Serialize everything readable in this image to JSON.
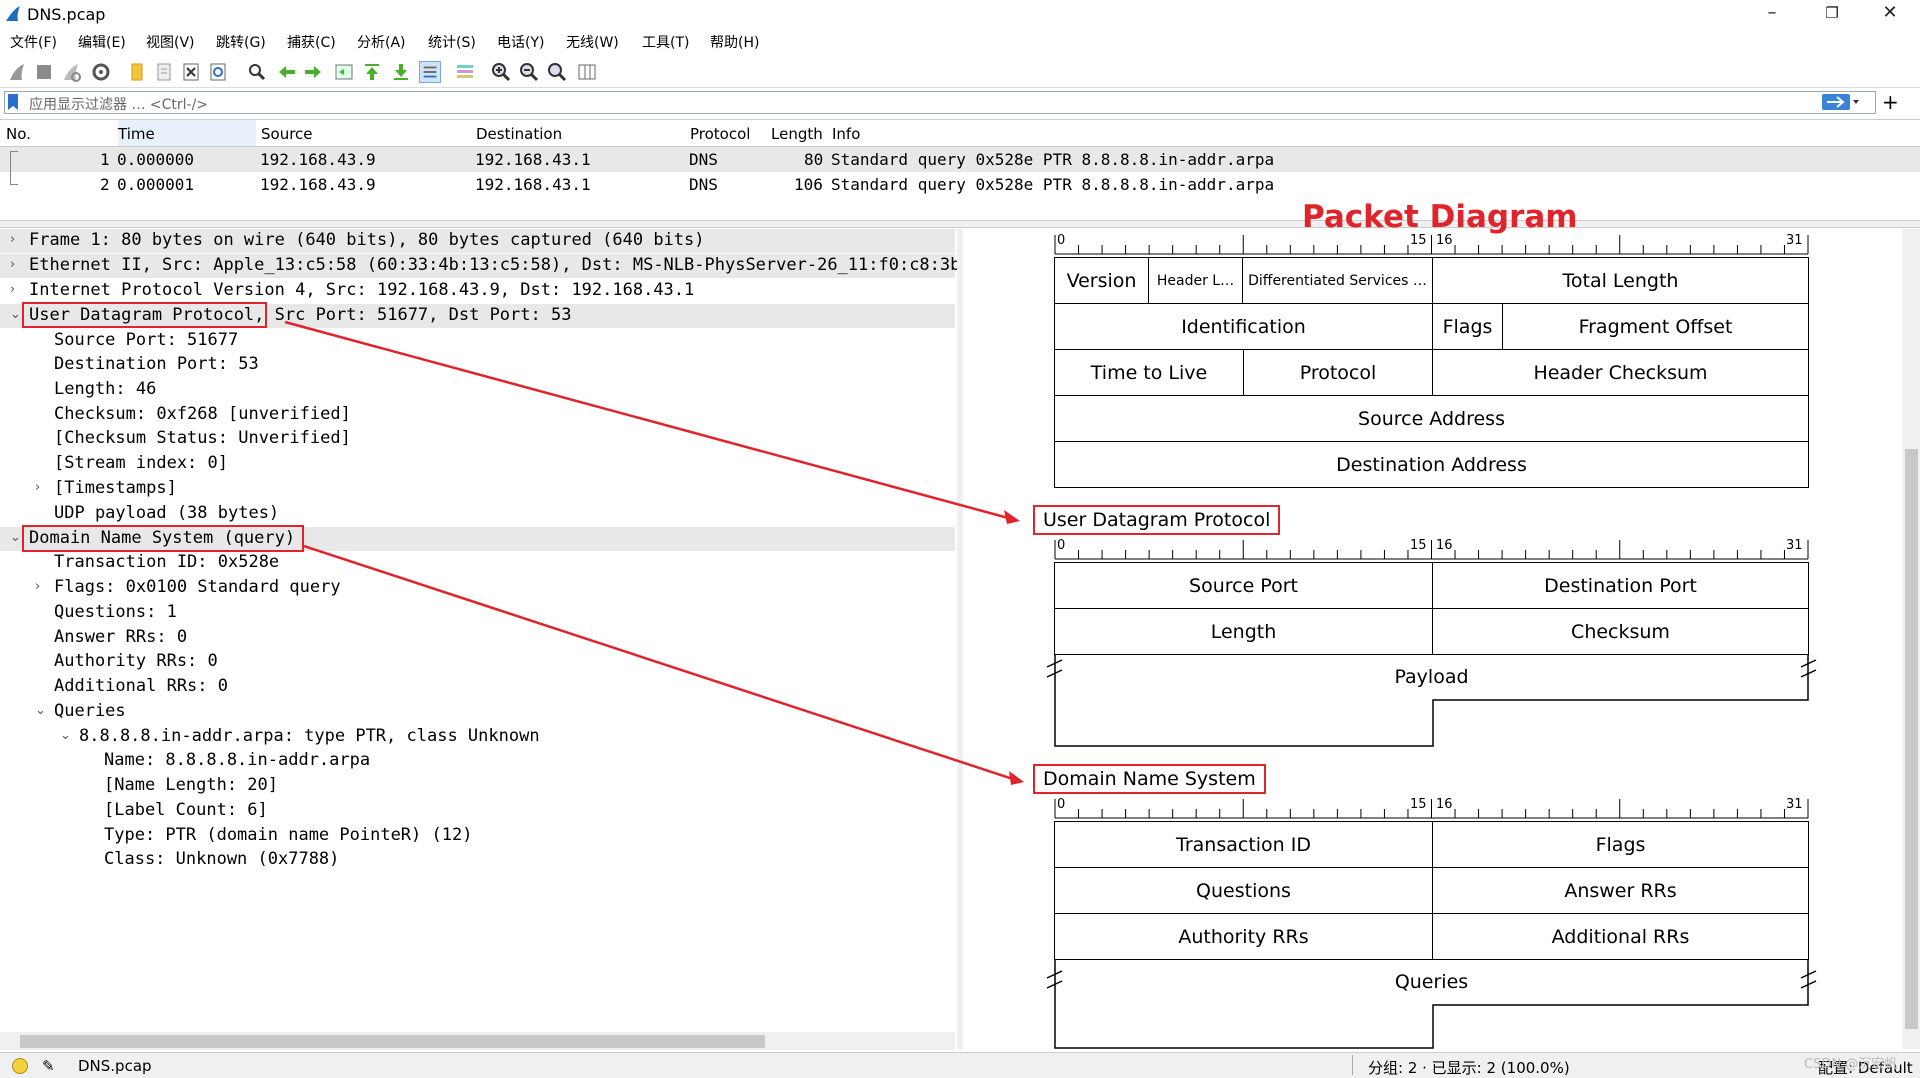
{
  "window": {
    "title": "DNS.pcap",
    "minimize": "–",
    "maximize": "❐",
    "close": "✕"
  },
  "menu": [
    "文件(F)",
    "编辑(E)",
    "视图(V)",
    "跳转(G)",
    "捕获(C)",
    "分析(A)",
    "统计(S)",
    "电话(Y)",
    "无线(W)",
    "工具(T)",
    "帮助(H)"
  ],
  "filter": {
    "placeholder": "应用显示过滤器 … <Ctrl-/>",
    "add": "+"
  },
  "packet_list": {
    "columns": [
      "No.",
      "Time",
      "Source",
      "Destination",
      "Protocol",
      "Length",
      "Info"
    ],
    "rows": [
      {
        "no": "1",
        "time": "0.000000",
        "source": "192.168.43.9",
        "destination": "192.168.43.1",
        "protocol": "DNS",
        "length": "80",
        "info": "Standard query 0x528e PTR 8.8.8.8.in-addr.arpa"
      },
      {
        "no": "2",
        "time": "0.000001",
        "source": "192.168.43.9",
        "destination": "192.168.43.1",
        "protocol": "DNS",
        "length": "106",
        "info": "Standard query 0x528e PTR 8.8.8.8.in-addr.arpa"
      }
    ]
  },
  "detail_tree": [
    {
      "text": "Frame 1: 80 bytes on wire (640 bits), 80 bytes captured (640 bits)",
      "arrow": ">"
    },
    {
      "text": "Ethernet II, Src: Apple_13:c5:58 (60:33:4b:13:c5:58), Dst: MS-NLB-PhysServer-26_11:f0:c8:3b",
      "arrow": ">"
    },
    {
      "text": "Internet Protocol Version 4, Src: 192.168.43.9, Dst: 192.168.43.1",
      "arrow": ">"
    },
    {
      "text": "User Datagram Protocol, Src Port: 51677, Dst Port: 53",
      "arrow": "v"
    },
    {
      "text": "Source Port: 51677",
      "arrow": ""
    },
    {
      "text": "Destination Port: 53",
      "arrow": ""
    },
    {
      "text": "Length: 46",
      "arrow": ""
    },
    {
      "text": "Checksum: 0xf268 [unverified]",
      "arrow": ""
    },
    {
      "text": "[Checksum Status: Unverified]",
      "arrow": ""
    },
    {
      "text": "[Stream index: 0]",
      "arrow": ""
    },
    {
      "text": "[Timestamps]",
      "arrow": ">"
    },
    {
      "text": "UDP payload (38 bytes)",
      "arrow": ""
    },
    {
      "text": "Domain Name System (query)",
      "arrow": "v"
    },
    {
      "text": "Transaction ID: 0x528e",
      "arrow": ""
    },
    {
      "text": "Flags: 0x0100 Standard query",
      "arrow": ">"
    },
    {
      "text": "Questions: 1",
      "arrow": ""
    },
    {
      "text": "Answer RRs: 0",
      "arrow": ""
    },
    {
      "text": "Authority RRs: 0",
      "arrow": ""
    },
    {
      "text": "Additional RRs: 0",
      "arrow": ""
    },
    {
      "text": "Queries",
      "arrow": "v"
    },
    {
      "text": "8.8.8.8.in-addr.arpa: type PTR, class Unknown",
      "arrow": "v"
    },
    {
      "text": "Name: 8.8.8.8.in-addr.arpa",
      "arrow": ""
    },
    {
      "text": "[Name Length: 20]",
      "arrow": ""
    },
    {
      "text": "[Label Count: 6]",
      "arrow": ""
    },
    {
      "text": "Type: PTR (domain name PointeR) (12)",
      "arrow": ""
    },
    {
      "text": "Class: Unknown (0x7788)",
      "arrow": ""
    }
  ],
  "packet_diagram": {
    "title": "Packet Diagram",
    "bit_labels": [
      "0",
      "15",
      "16",
      "31"
    ],
    "ip": [
      "Version",
      "Header L…",
      "Differentiated Services …",
      "Total Length",
      "Identification",
      "Flags",
      "Fragment Offset",
      "Time to Live",
      "Protocol",
      "Header Checksum",
      "Source Address",
      "Destination Address"
    ],
    "udp_label": "User Datagram Protocol",
    "udp": [
      "Source Port",
      "Destination Port",
      "Length",
      "Checksum",
      "Payload"
    ],
    "dns_label": "Domain Name System",
    "dns": [
      "Transaction ID",
      "Flags",
      "Questions",
      "Answer RRs",
      "Authority RRs",
      "Additional RRs",
      "Queries"
    ]
  },
  "status": {
    "file": "DNS.pcap",
    "counts": "分组: 2 · 已显示: 2 (100.0%)",
    "profile": "配置: Default",
    "watermark": "CSDN @沉宏帆"
  },
  "colors": {
    "accent_red": "#e0242c",
    "selected_row": "#e8e8e8"
  }
}
